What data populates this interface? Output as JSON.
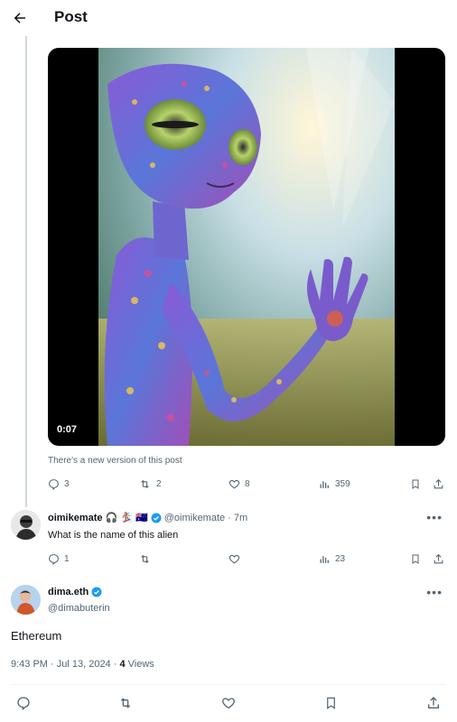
{
  "header": {
    "title": "Post"
  },
  "media": {
    "duration": "0:07"
  },
  "notice": "There's a new version of this post",
  "original_actions": {
    "replies": "3",
    "reposts": "2",
    "likes": "8",
    "views": "359"
  },
  "reply": {
    "display_name": "oimikemate",
    "emojis": "🎧 🏂 🇦🇺",
    "handle": "@oimikemate",
    "time": "· 7m",
    "text": "What is the name of this alien",
    "actions": {
      "replies": "1",
      "views": "23"
    }
  },
  "main_post": {
    "display_name": "dima.eth",
    "handle": "@dimabuterin",
    "text": "Ethereum",
    "timestamp": "9:43 PM · Jul 13, 2024 · ",
    "views_count": "4",
    "views_label": " Views"
  },
  "colors": {
    "verified": "#1d9bf0",
    "secondary_text": "#536471"
  }
}
